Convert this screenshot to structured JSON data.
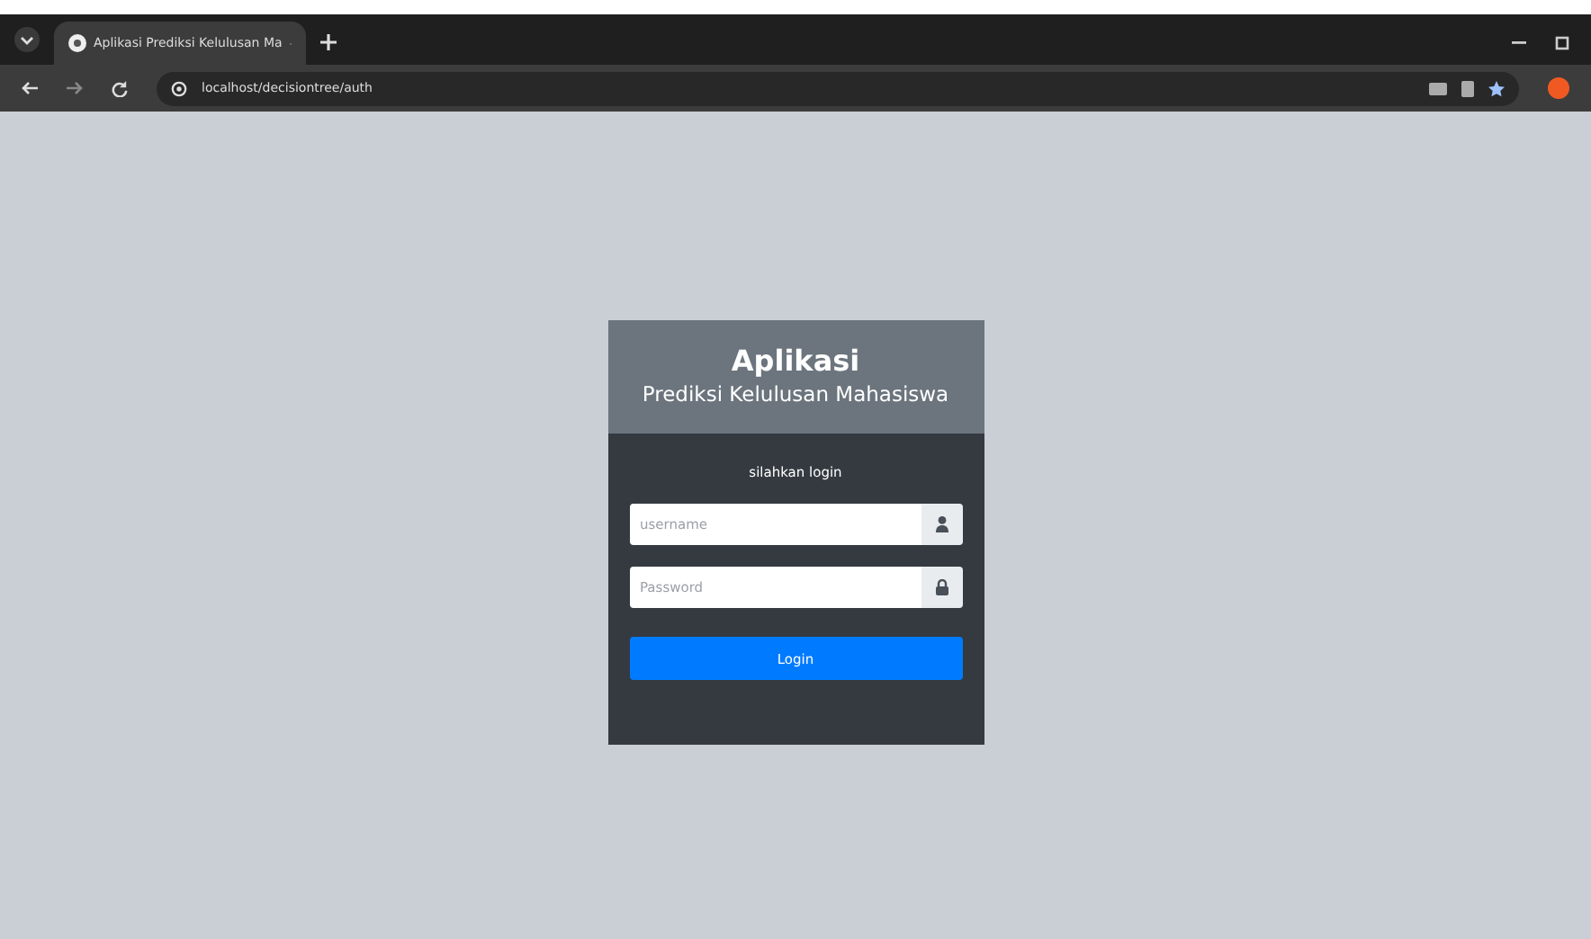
{
  "browser": {
    "tab_title": "Aplikasi Prediksi Kelulusan Ma",
    "url": "localhost/decisiontree/auth"
  },
  "login_card": {
    "title": "Aplikasi",
    "subtitle": "Prediksi Kelulusan Mahasiswa",
    "prompt": "silahkan login",
    "fields": [
      {
        "kind": "user",
        "placeholder": "username"
      },
      {
        "kind": "lock",
        "placeholder": "Password"
      }
    ],
    "button": "Login"
  }
}
